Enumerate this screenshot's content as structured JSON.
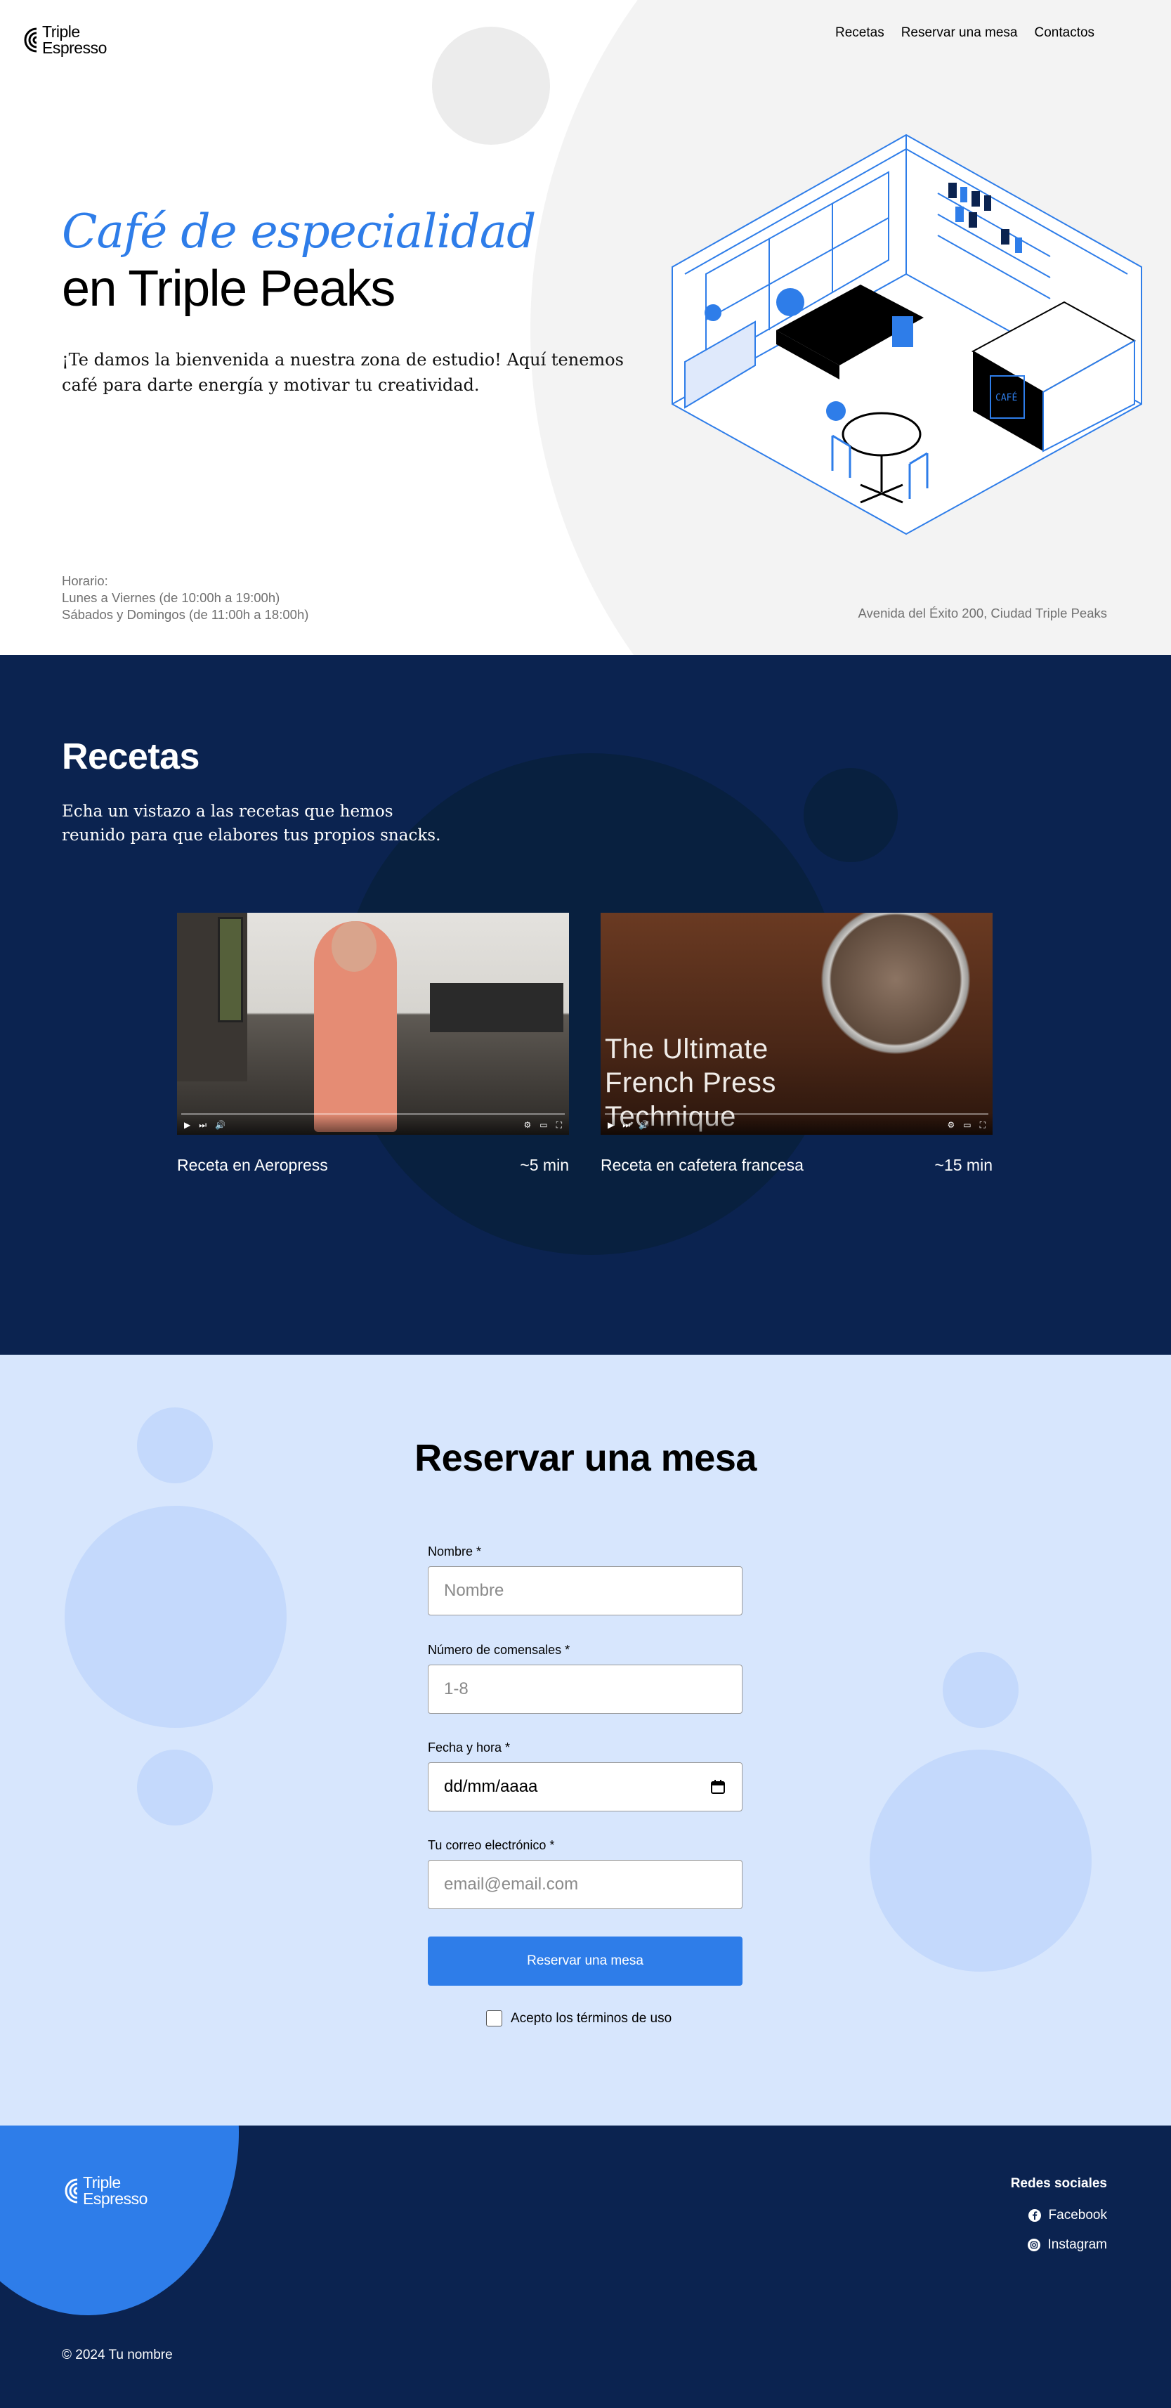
{
  "brand": {
    "line1": "Triple",
    "line2": "Espresso",
    "accent": "#2e7de9",
    "navy": "#0b2350",
    "light_blue": "#d7e6fd"
  },
  "nav": [
    "Recetas",
    "Reservar una mesa",
    "Contactos"
  ],
  "hero": {
    "title_highlight": "Café de especialidad",
    "title_rest": "en Triple Peaks",
    "lead": "¡Te damos la bienvenida a nuestra zona de estudio! Aquí tenemos café para darte energía y motivar tu creatividad.",
    "hours": [
      "Horario:",
      "Lunes a Viernes (de 10:00h a 19:00h)",
      "Sábados y Domingos (de 11:00h a 18:00h)"
    ],
    "address": "Avenida del Éxito 200, Ciudad Triple Peaks",
    "illustration_sign": "CAFÉ"
  },
  "recipes": {
    "title": "Recetas",
    "lead": "Echa un vistazo a las recetas que hemos reunido para que elabores tus propios snacks.",
    "videos": [
      {
        "name": "Receta en Aeropress",
        "duration": "~5 min",
        "overlay": ""
      },
      {
        "name": "Receta en cafetera francesa",
        "duration": "~15 min",
        "overlay_lines": [
          "The Ultimate",
          "French Press",
          "Technique"
        ]
      }
    ]
  },
  "reserve": {
    "title": "Reservar una mesa",
    "fields": [
      {
        "label": "Nombre *",
        "placeholder": "Nombre",
        "value": ""
      },
      {
        "label": "Número de comensales *",
        "placeholder": "1-8",
        "value": ""
      },
      {
        "label": "Fecha y hora *",
        "placeholder": "",
        "value": "dd/mm/aaaa"
      },
      {
        "label": "Tu correo electrónico *",
        "placeholder": "email@email.com",
        "value": ""
      }
    ],
    "submit": "Reservar una mesa",
    "terms": "Acepto los términos de uso"
  },
  "footer": {
    "social_title": "Redes sociales",
    "social": [
      {
        "label": "Facebook",
        "icon": "facebook-icon"
      },
      {
        "label": "Instagram",
        "icon": "instagram-icon"
      }
    ],
    "copyright": "© 2024 Tu nombre"
  }
}
